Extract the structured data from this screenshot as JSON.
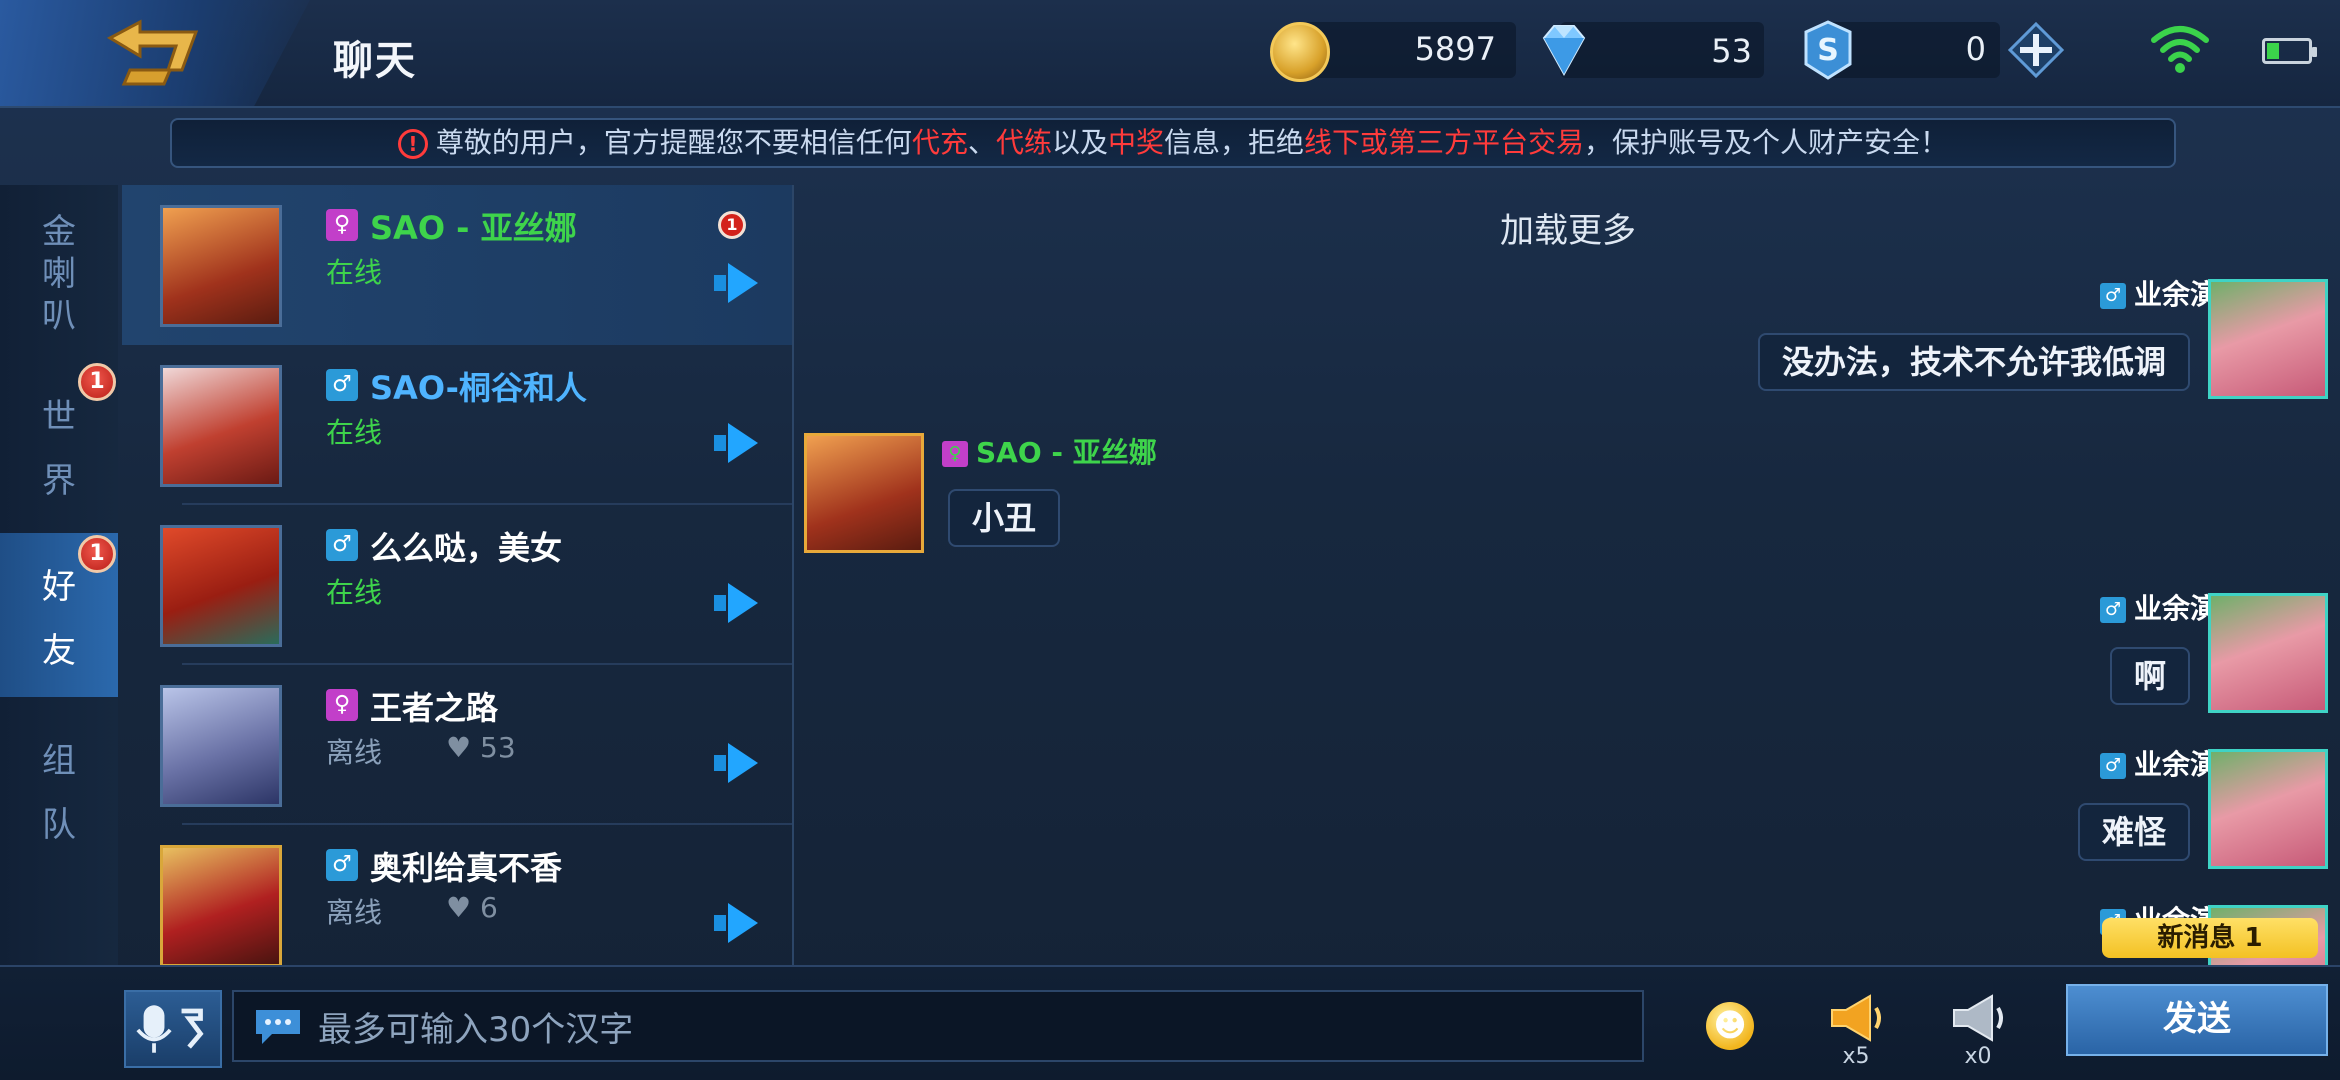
{
  "header": {
    "title": "聊天",
    "gold": "5897",
    "diamonds": "53",
    "coupons": "0"
  },
  "notice": {
    "p1": "尊敬的用户，官方提醒您不要相信任何",
    "r1": "代充",
    "p2": "、",
    "r2": "代练",
    "p3": "以及",
    "r3": "中奖",
    "p4": "信息，拒绝",
    "r4": "线下或第三方平台交易",
    "p5": "，保护账号及个人财产安全！",
    "icon_symbol": "!"
  },
  "tabs": [
    {
      "label1": "金",
      "label2": "喇",
      "label3": "叭",
      "badge": ""
    },
    {
      "label1": "世",
      "label2": "界",
      "badge": "1"
    },
    {
      "label1": "好",
      "label2": "友",
      "badge": "1"
    },
    {
      "label1": "组",
      "label2": "队",
      "badge": ""
    }
  ],
  "friends": [
    {
      "gender_symbol": "♀",
      "name": "SAO - 亚丝娜",
      "status": "在线",
      "unread": "1",
      "name_color": "#3ed44b"
    },
    {
      "gender_symbol": "♂",
      "name": "SAO-桐谷和人",
      "status": "在线",
      "name_color": "#4fb4ff"
    },
    {
      "gender_symbol": "♂",
      "name": "么么哒，美女",
      "status": "在线",
      "name_color": "#ffffff"
    },
    {
      "gender_symbol": "♀",
      "name": "王者之路",
      "status": "离线",
      "intimacy": "53",
      "name_color": "#ffffff"
    },
    {
      "gender_symbol": "♂",
      "name": "奥利给真不香",
      "status": "离线",
      "intimacy": "6",
      "name_color": "#ffffff"
    }
  ],
  "chat": {
    "load_more": "加载更多",
    "messages": [
      {
        "sender": "业余演员",
        "gender_symbol": "♂",
        "text": "没办法，技术不允许我低调",
        "side": "right"
      },
      {
        "sender": "SAO - 亚丝娜",
        "gender_symbol": "♀",
        "text": "小丑",
        "side": "left"
      },
      {
        "sender": "业余演员",
        "gender_symbol": "♂",
        "text": "啊",
        "side": "right"
      },
      {
        "sender": "业余演员",
        "gender_symbol": "♂",
        "text": "难怪",
        "side": "right"
      },
      {
        "sender": "业余演员",
        "gender_symbol": "♂",
        "text": "",
        "side": "right"
      }
    ],
    "new_message_label": "新消息 1"
  },
  "input": {
    "placeholder": "最多可输入30个汉字"
  },
  "bottom": {
    "big_horn_count": "x5",
    "small_horn_count": "x0",
    "send_label": "发送"
  },
  "colors": {
    "accent_blue": "#2b69ad",
    "online_green": "#3ed44b",
    "warning_red": "#ff3b3b",
    "new_msg_yellow": "#f3c123"
  }
}
